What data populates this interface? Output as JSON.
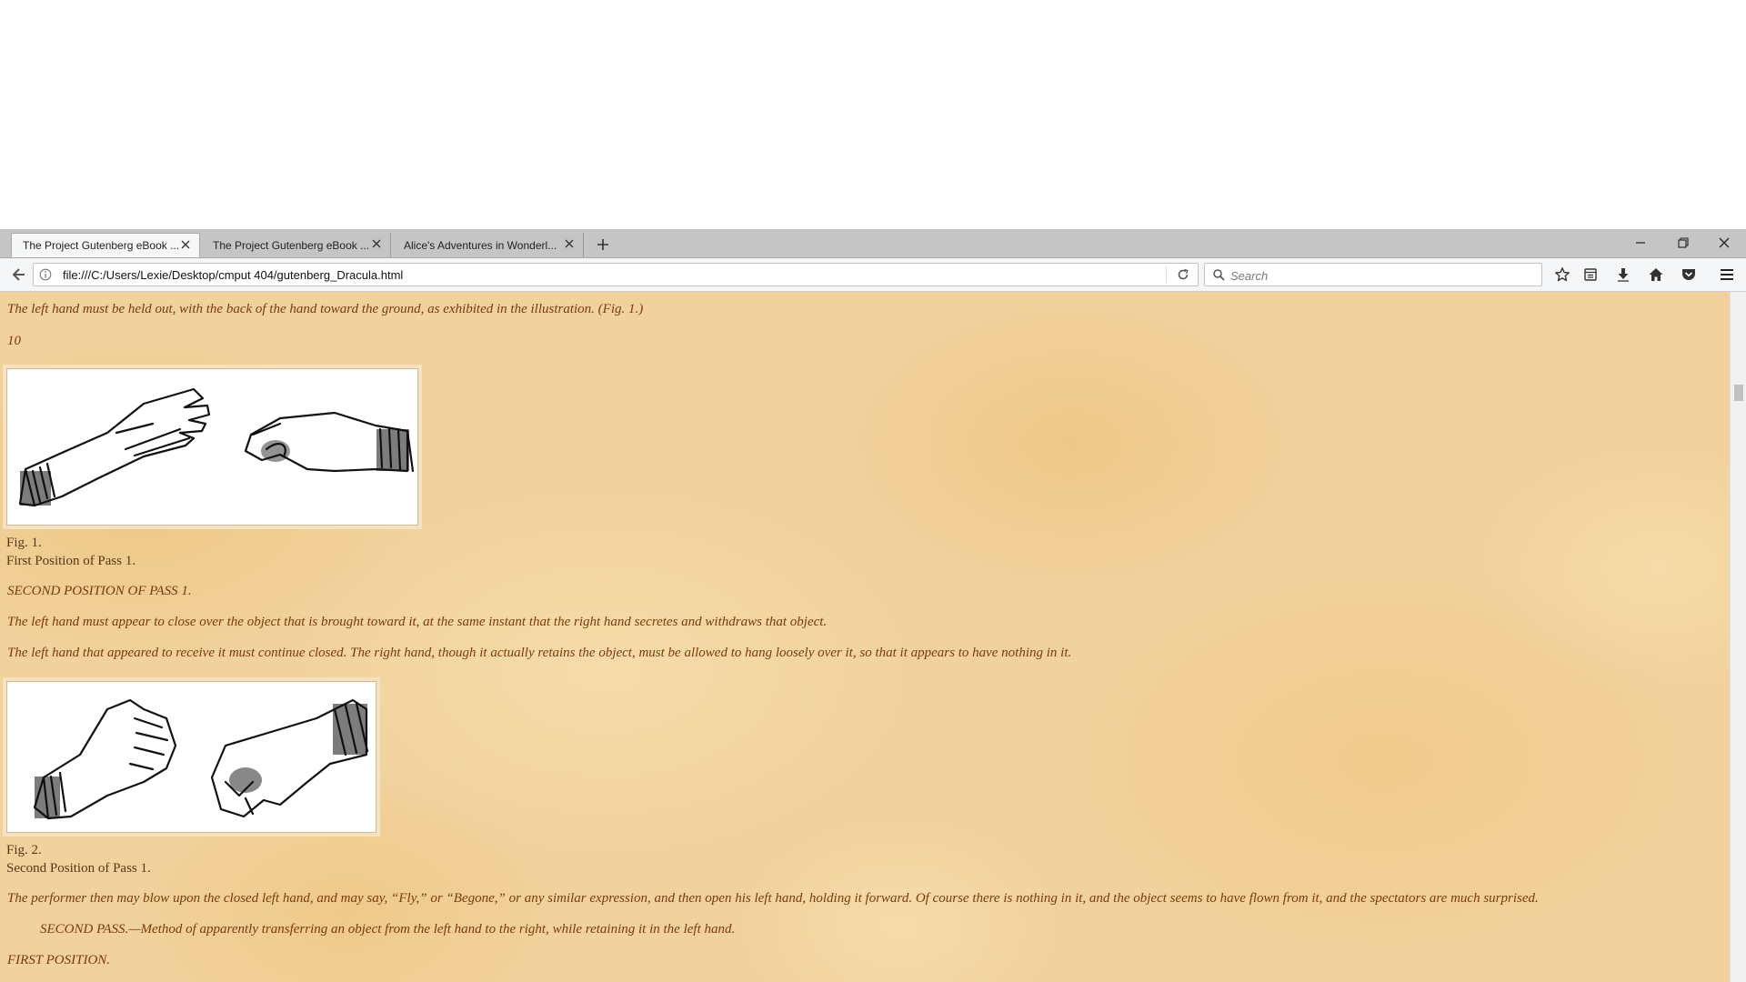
{
  "browser": {
    "tabs": [
      {
        "label": "The Project Gutenberg eBook ...",
        "active": true
      },
      {
        "label": "The Project Gutenberg eBook ...",
        "active": false
      },
      {
        "label": "Alice's Adventures in Wonderl...",
        "active": false
      }
    ],
    "url": "file:///C:/Users/Lexie/Desktop/cmput 404/gutenberg_Dracula.html",
    "search_placeholder": "Search"
  },
  "page": {
    "para_1": "The left hand must be held out, with the back of the hand toward the ground, as exhibited in the illustration. (Fig. 1.)",
    "page_number": "10",
    "figure_1": {
      "label": "Fig. 1.",
      "caption": "First Position of Pass 1."
    },
    "heading_second_position": "SECOND POSITION OF PASS 1.",
    "para_2": "The left hand must appear to close over the object that is brought toward it, at the same instant that the right hand secretes and withdraws that object.",
    "para_3": "The left hand that appeared to receive it must continue closed. The right hand, though it actually retains the object, must be allowed to hang loosely over it, so that it appears to have nothing in it.",
    "figure_2": {
      "label": "Fig. 2.",
      "caption": "Second Position of Pass 1."
    },
    "para_4": "The performer then may blow upon the closed left hand, and may say, “Fly,” or “Begone,” or any similar expression, and then open his left hand, holding it forward. Of course there is nothing in it, and the object seems to have flown from it, and the spectators are much surprised.",
    "para_5": "SECOND PASS.—Method of apparently transferring an object from the left hand to the right, while retaining it in the left hand.",
    "heading_first_position": "FIRST POSITION."
  },
  "colors": {
    "text": "#7a3a0c",
    "caption_text": "#5a3518",
    "parchment": "#f1d29c",
    "tabstrip": "#c5c5c5",
    "toolbar": "#f5f6f7"
  },
  "icons": [
    "close-icon",
    "plus-icon",
    "minimize-icon",
    "restore-icon",
    "back-arrow-icon",
    "info-icon",
    "reload-icon",
    "search-icon",
    "star-icon",
    "reading-list-icon",
    "download-icon",
    "home-icon",
    "pocket-icon",
    "hamburger-menu-icon"
  ]
}
